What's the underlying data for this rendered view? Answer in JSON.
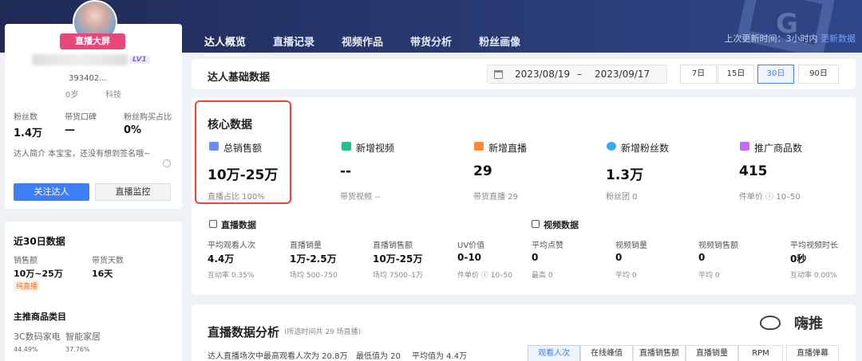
{
  "header": {
    "tabs": [
      "达人概览",
      "直播记录",
      "视频作品",
      "带货分析",
      "粉丝画像"
    ],
    "update_prefix": "上次更新时间：3小时内",
    "update_link": "更新数据"
  },
  "profile": {
    "live_badge": "直播大屏",
    "level": "LV1",
    "uid": "393402...",
    "age": "0岁",
    "category": "科技",
    "stats": [
      {
        "label": "粉丝数",
        "value": "1.4万"
      },
      {
        "label": "带货口碑",
        "value": "—"
      },
      {
        "label": "粉丝购买占比",
        "value": "0%"
      }
    ],
    "intro": "达人简介 本宝宝，还没有想到签名哦~",
    "follow_button": "关注达人",
    "monitor_button": "直播监控"
  },
  "recent": {
    "title": "近30日数据",
    "sales_label": "销售额",
    "sales_value": "10万~25万",
    "days_label": "带货天数",
    "days_value": "16天",
    "tag": "纯直播",
    "main_cat_title": "主推商品类目",
    "cats": [
      {
        "name": "3C数码家电",
        "pct": "44.49%"
      },
      {
        "name": "智能家居",
        "pct": "37.76%"
      }
    ]
  },
  "basic": {
    "title": "达人基础数据",
    "date_start": "2023/08/19",
    "date_sep": "–",
    "date_end": "2023/09/17",
    "ranges": [
      "7日",
      "15日",
      "30日",
      "90日"
    ],
    "active_range": "30日"
  },
  "core": {
    "title": "核心数据",
    "metrics": [
      {
        "label": "总销售额",
        "value": "10万-25万",
        "sub": "直播占比 100%",
        "color": "#6c8cf5"
      },
      {
        "label": "新增视频",
        "value": "--",
        "sub": "带货视频 --",
        "color": "#22c18a"
      },
      {
        "label": "新增直播",
        "value": "29",
        "sub": "带货直播 29",
        "color": "#ff8a3d"
      },
      {
        "label": "新增粉丝数",
        "value": "1.3万",
        "sub": "粉丝团 0",
        "color": "#3aa8f5"
      },
      {
        "label": "推广商品数",
        "value": "415",
        "sub": "件单价 ⓘ 10–50",
        "color": "#c46cf0"
      }
    ]
  },
  "live": {
    "title": "直播数据",
    "cols": [
      {
        "label": "平均观看人次",
        "value": "4.4万",
        "sub": "互动率 0.35%"
      },
      {
        "label": "直播销量",
        "value": "1万-2.5万",
        "sub": "场均 500–750"
      },
      {
        "label": "直播销售额",
        "value": "10万-25万",
        "sub": "场均 7500–1万"
      },
      {
        "label": "UV价值",
        "value": "0-10",
        "sub": "件单价 ⓘ 10–50"
      }
    ]
  },
  "video": {
    "title": "视频数据",
    "cols": [
      {
        "label": "平均点赞",
        "value": "0",
        "sub": "最高 0"
      },
      {
        "label": "视频销量",
        "value": "0",
        "sub": "平均 0"
      },
      {
        "label": "视频销售额",
        "value": "0",
        "sub": "平均 0"
      },
      {
        "label": "平均视频时长",
        "value": "0秒",
        "sub": "互动率 0.00%"
      }
    ]
  },
  "analysis": {
    "title": "直播数据分析",
    "subtitle": "(所选时间共 29 场直播)",
    "notes": [
      "达人直播场次中最高观看人次为 20.8万",
      "最低值为 20",
      "平均值为 4.4万"
    ],
    "buttons": [
      "观看人次",
      "在线峰值",
      "直播销售额",
      "直播销量",
      "RPM",
      "直播弹幕"
    ],
    "active_button": "观看人次"
  },
  "watermark": "嗨推"
}
